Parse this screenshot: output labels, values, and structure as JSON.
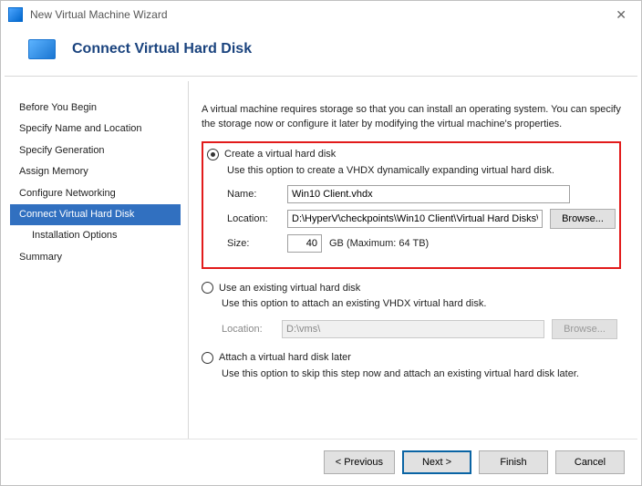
{
  "titlebar": {
    "title": "New Virtual Machine Wizard"
  },
  "header": {
    "title": "Connect Virtual Hard Disk"
  },
  "sidebar": {
    "items": [
      {
        "label": "Before You Begin"
      },
      {
        "label": "Specify Name and Location"
      },
      {
        "label": "Specify Generation"
      },
      {
        "label": "Assign Memory"
      },
      {
        "label": "Configure Networking"
      },
      {
        "label": "Connect Virtual Hard Disk"
      },
      {
        "label": "Installation Options"
      },
      {
        "label": "Summary"
      }
    ]
  },
  "content": {
    "intro": "A virtual machine requires storage so that you can install an operating system. You can specify the storage now or configure it later by modifying the virtual machine's properties.",
    "opt_create": {
      "label": "Create a virtual hard disk",
      "desc": "Use this option to create a VHDX dynamically expanding virtual hard disk.",
      "name_label": "Name:",
      "name_value": "Win10 Client.vhdx",
      "loc_label": "Location:",
      "loc_value": "D:\\HyperV\\checkpoints\\Win10 Client\\Virtual Hard Disks\\",
      "browse_label": "Browse...",
      "size_label": "Size:",
      "size_value": "40",
      "size_suffix": "GB (Maximum: 64 TB)"
    },
    "opt_existing": {
      "label": "Use an existing virtual hard disk",
      "desc": "Use this option to attach an existing VHDX virtual hard disk.",
      "loc_label": "Location:",
      "loc_value": "D:\\vms\\",
      "browse_label": "Browse..."
    },
    "opt_later": {
      "label": "Attach a virtual hard disk later",
      "desc": "Use this option to skip this step now and attach an existing virtual hard disk later."
    }
  },
  "footer": {
    "prev": "< Previous",
    "next": "Next >",
    "finish": "Finish",
    "cancel": "Cancel"
  }
}
